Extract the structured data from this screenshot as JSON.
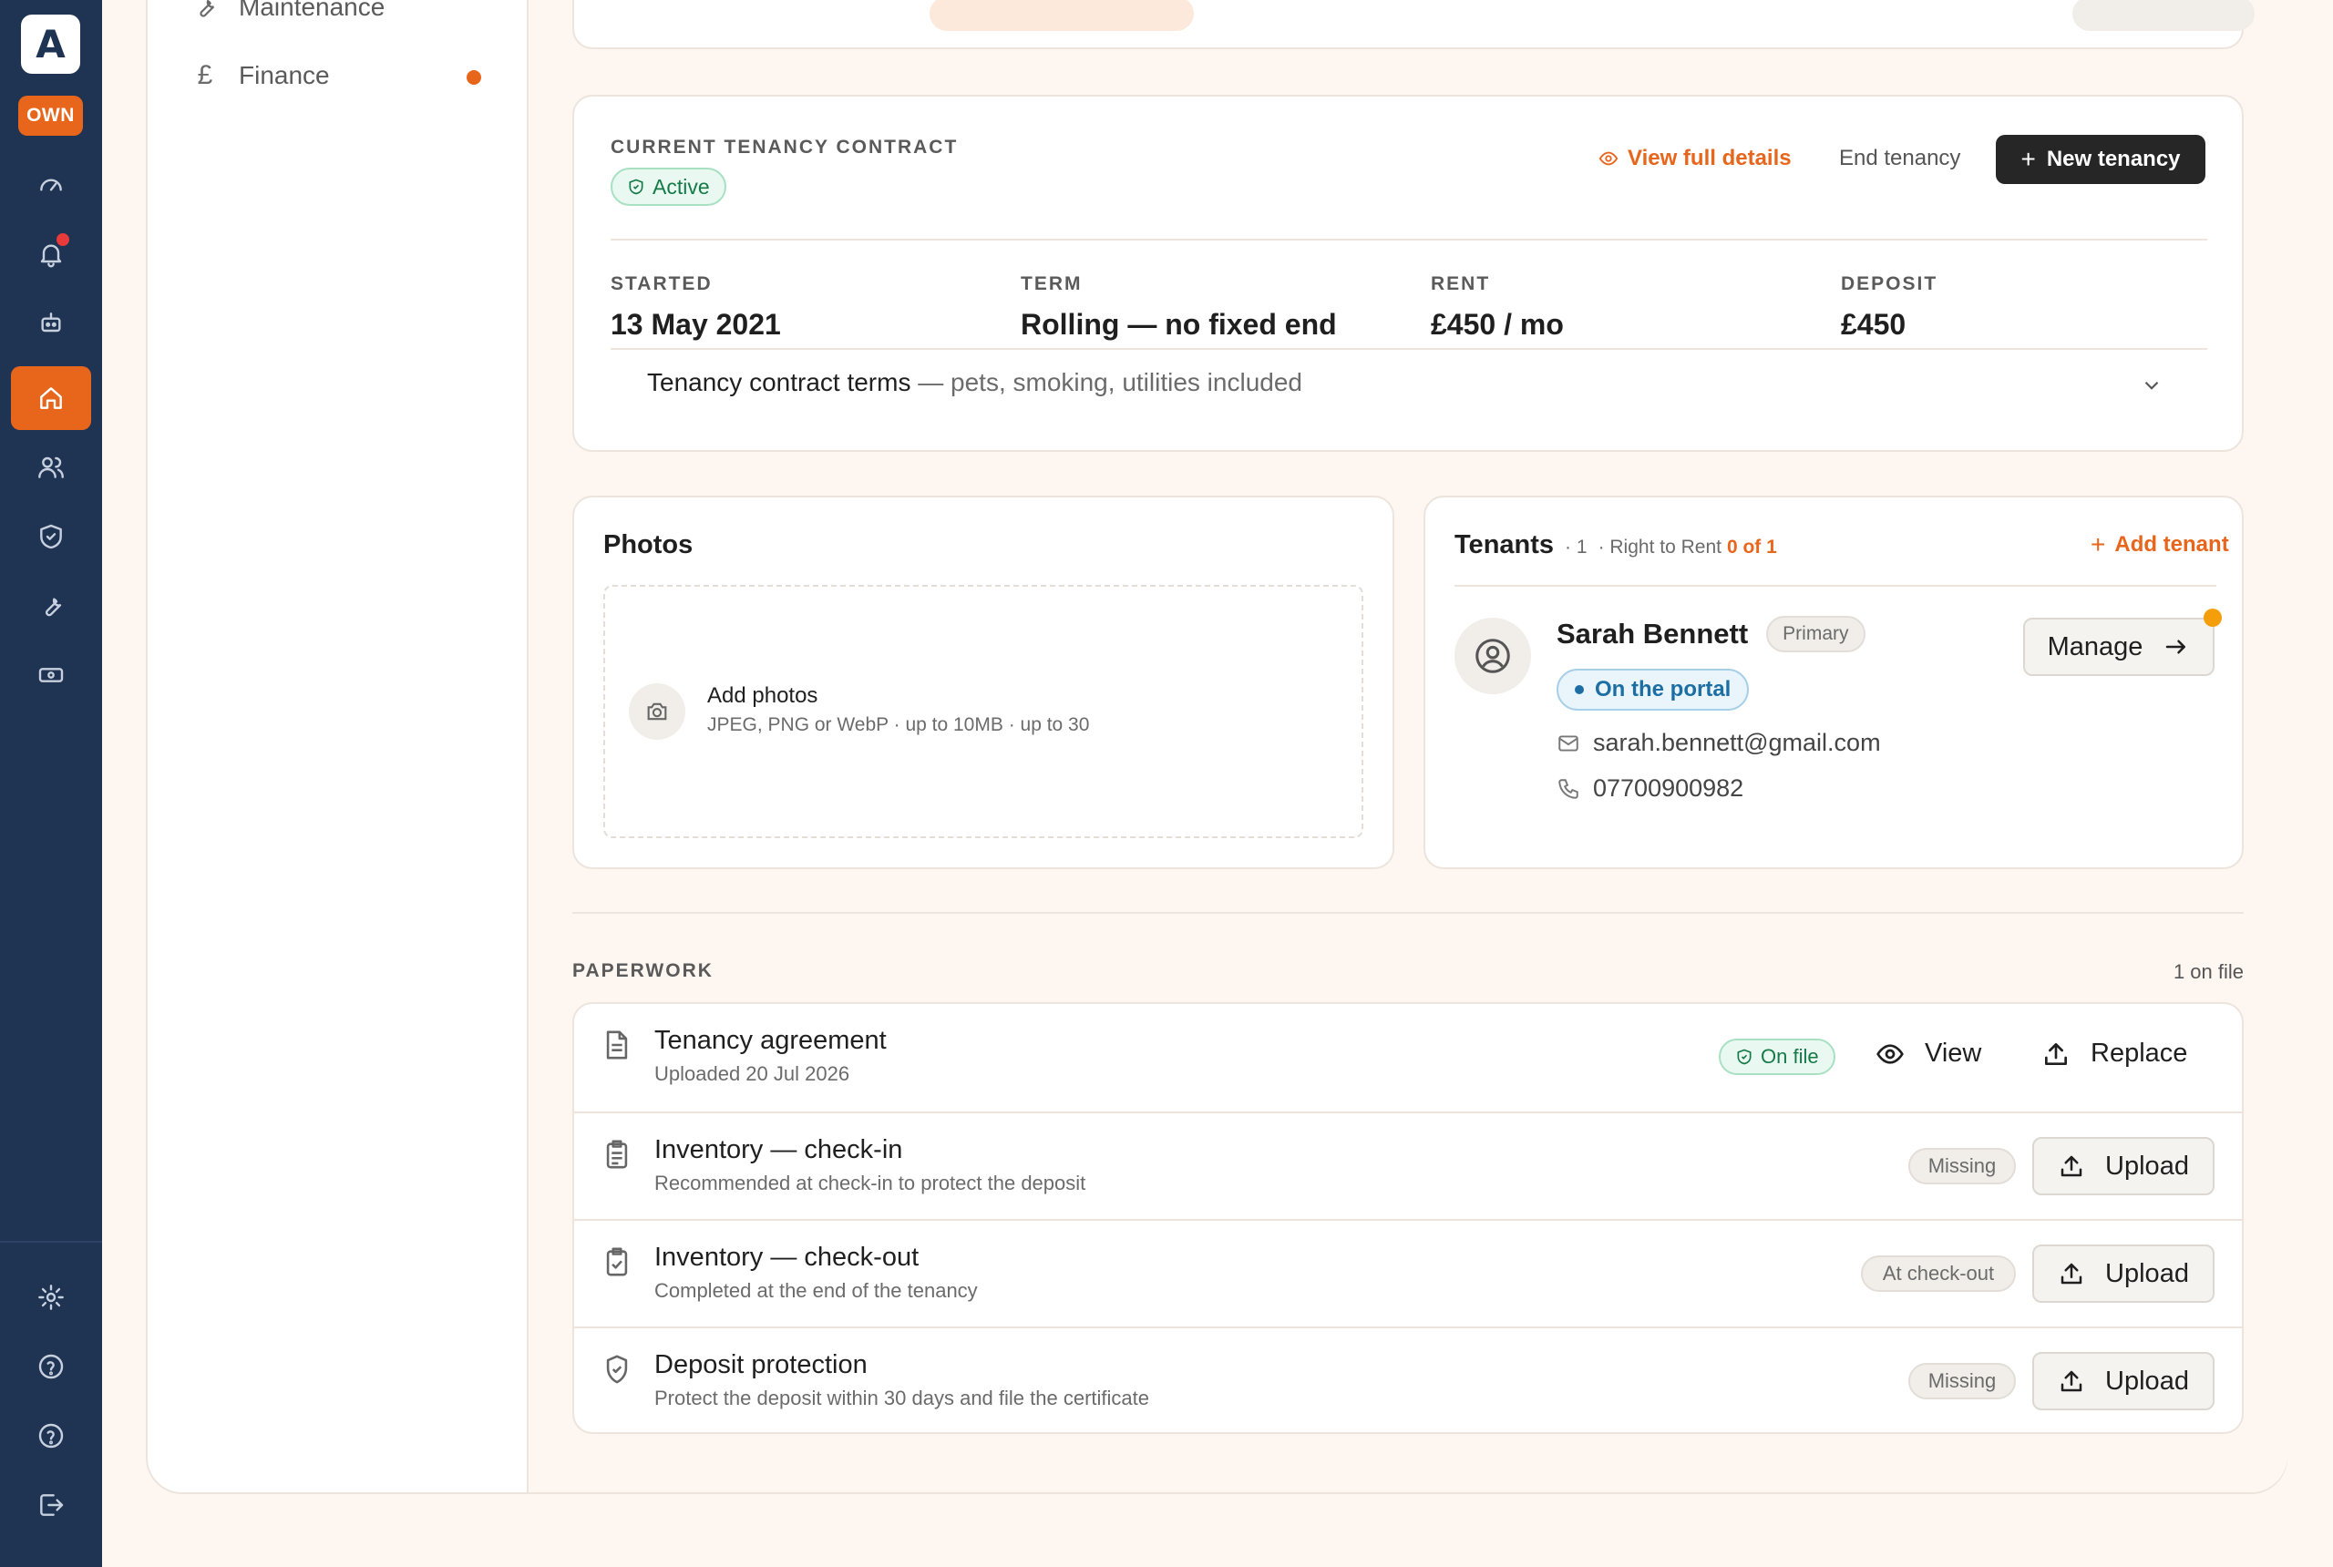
{
  "rail": {
    "logo_letter": "A",
    "badge": "OWN",
    "icons": [
      "dashboard-icon",
      "bell-icon",
      "robot-icon",
      "home-icon",
      "people-icon",
      "shield-icon",
      "wrench-icon",
      "cash-icon"
    ],
    "bottom_icons": [
      "gear-icon",
      "help-icon",
      "help-circle-icon",
      "logout-icon"
    ]
  },
  "subnav": {
    "items": [
      {
        "label": "Maintenance",
        "icon": "wrench-icon"
      },
      {
        "label": "Finance",
        "icon": "pound-icon"
      }
    ]
  },
  "tenancy": {
    "eyebrow": "CURRENT TENANCY CONTRACT",
    "status": "Active",
    "view_details": "View full details",
    "end_tenancy": "End tenancy",
    "new_tenancy": "New tenancy",
    "fields": [
      {
        "label": "STARTED",
        "value": "13 May 2021"
      },
      {
        "label": "TERM",
        "value": "Rolling — no fixed end"
      },
      {
        "label": "RENT",
        "value": "£450 / mo"
      },
      {
        "label": "DEPOSIT",
        "value": "£450"
      }
    ],
    "terms_title": "Tenancy contract terms",
    "terms_detail": "— pets, smoking, utilities included"
  },
  "photos": {
    "title": "Photos",
    "add_title": "Add photos",
    "add_hint": "JPEG, PNG or WebP · up to 10MB · up to 30"
  },
  "tenants": {
    "title": "Tenants",
    "count": "· 1",
    "rtr_prefix": "· Right to Rent",
    "rtr_value": "0 of 1",
    "add": "Add tenant",
    "person": {
      "name": "Sarah Bennett",
      "role": "Primary",
      "portal": "On the portal",
      "email": "sarah.bennett@gmail.com",
      "phone": "07700900982",
      "manage": "Manage"
    }
  },
  "paperwork": {
    "eyebrow": "PAPERWORK",
    "count": "1 on file",
    "rows": [
      {
        "title": "Tenancy agreement",
        "sub": "Uploaded 20 Jul 2026",
        "status": "On file",
        "view": "View",
        "replace": "Replace"
      },
      {
        "title": "Inventory — check-in",
        "sub": "Recommended at check-in to protect the deposit",
        "status": "Missing",
        "action": "Upload"
      },
      {
        "title": "Inventory — check-out",
        "sub": "Completed at the end of the tenancy",
        "status": "At check-out",
        "action": "Upload"
      },
      {
        "title": "Deposit protection",
        "sub": "Protect the deposit within 30 days and file the certificate",
        "status": "Missing",
        "action": "Upload"
      }
    ]
  },
  "colors": {
    "accent": "#e8661c",
    "rail": "#1f3352",
    "success": "#157a48",
    "info": "#1d6fa3"
  }
}
